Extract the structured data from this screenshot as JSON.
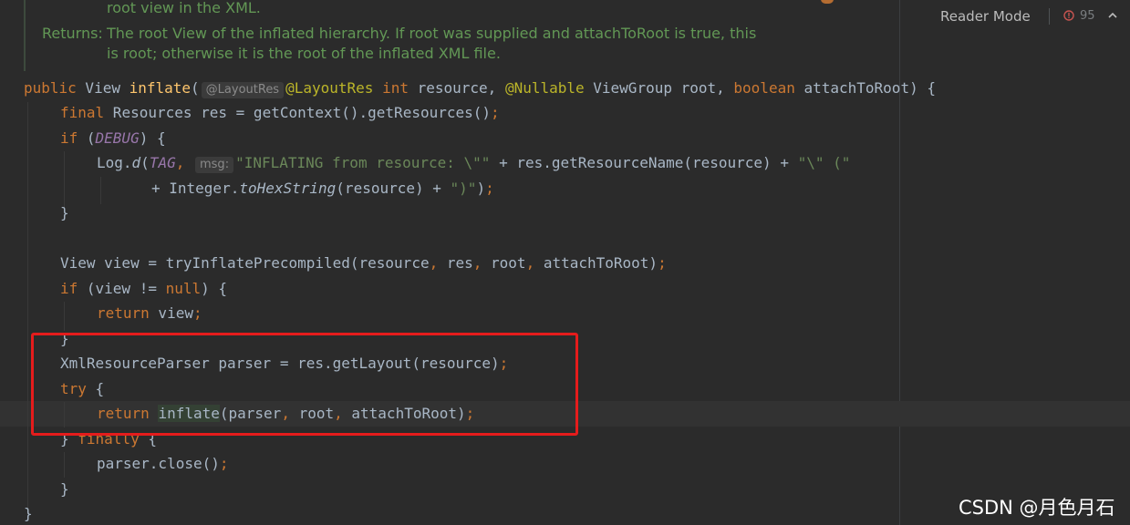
{
  "doc": {
    "line1": "root view in the XML.",
    "returns_label": "Returns:",
    "returns_line1": "The root View of the inflated hierarchy. If root was supplied and attachToRoot is true, this",
    "returns_line2": "is root; otherwise it is the root of the inflated XML file."
  },
  "toolbar": {
    "reader_mode": "Reader Mode",
    "warning_count": "95"
  },
  "code": {
    "l1": {
      "kw1": "public",
      "t1": " View ",
      "fn": "inflate",
      "p1": "(",
      "hint": "@LayoutRes",
      "ann1": "@LayoutRes",
      "sp1": " ",
      "kw2": "int",
      "t2": " resource, ",
      "ann2": "@Nullable",
      "t3": " ViewGroup root, ",
      "kw3": "boolean",
      "t4": " attachToRoot) {"
    },
    "l2": {
      "kw1": "final",
      "t1": " Resources res = getContext().getResources()",
      "semi": ";"
    },
    "l3": {
      "kw1": "if",
      "t1": " (",
      "const": "DEBUG",
      "t2": ") {"
    },
    "l4": {
      "t1": "Log.",
      "static": "d",
      "t2": "(",
      "const": "TAG",
      "comma": ",",
      "hint": "msg:",
      "str1": "\"INFLATING from resource: \\\"\"",
      "t3": " + res.getResourceName(resource) + ",
      "str2": "\"\\\" (\""
    },
    "l5": {
      "t1": "+ Integer.",
      "static": "toHexString",
      "t2": "(resource) + ",
      "str": "\")\"",
      "t3": ")",
      "semi": ";"
    },
    "l6": {
      "t1": "}"
    },
    "l7": {
      "t1": "View view = tryInflatePrecompiled(resource",
      "c1": ",",
      "t2": " res",
      "c2": ",",
      "t3": " root",
      "c3": ",",
      "t4": " attachToRoot)",
      "semi": ";"
    },
    "l8": {
      "kw1": "if",
      "t1": " (view != ",
      "kw2": "null",
      "t2": ") {"
    },
    "l9": {
      "kw1": "return",
      "t1": " view",
      "semi": ";"
    },
    "l10": {
      "t1": "}"
    },
    "l11": {
      "t1": "XmlResourceParser parser = res.getLayout(resource)",
      "semi": ";"
    },
    "l12": {
      "kw1": "try",
      "t1": " {"
    },
    "l13": {
      "kw1": "return",
      "sp": " ",
      "hl": "inflate",
      "t1": "(parser",
      "c1": ",",
      "t2": " root",
      "c2": ",",
      "t3": " attachToRoot)",
      "semi": ";"
    },
    "l14": {
      "t1": "} ",
      "kw1": "finally",
      "t2": " {"
    },
    "l15": {
      "t1": "parser.close()",
      "semi": ";"
    },
    "l16": {
      "t1": "}"
    },
    "l17": {
      "t1": "}"
    }
  },
  "watermark": "CSDN @月色月石",
  "colors": {
    "background": "#2b2b2b",
    "keyword": "#cc7832",
    "function": "#ffc66d",
    "annotation": "#bbb529",
    "string": "#6a8759",
    "constant": "#9876aa",
    "doc": "#629755",
    "highlight_box": "#e51c1c"
  },
  "icons": [
    "warning-icon",
    "chevron-up-icon"
  ]
}
